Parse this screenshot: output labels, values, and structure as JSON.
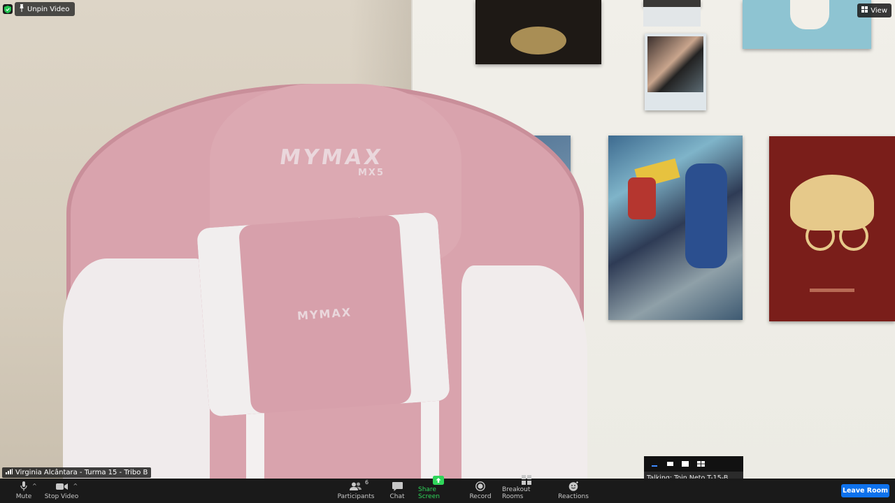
{
  "meeting": {
    "unpin_label": "Unpin Video",
    "view_label": "View",
    "participant_name": "Virginia Alcântara - Turma 15 - Tribo B",
    "talking_text": "Talking: Toin Neto T-15-B"
  },
  "scene": {
    "chair_logo": "MYMAX",
    "chair_logo_sub": "MX5",
    "pillow_logo": "MYMAX"
  },
  "toolbar": {
    "mute_label": "Mute",
    "stop_video_label": "Stop Video",
    "participants_label": "Participants",
    "participants_count": "6",
    "chat_label": "Chat",
    "share_screen_label": "Share Screen",
    "record_label": "Record",
    "breakout_rooms_label": "Breakout Rooms",
    "reactions_label": "Reactions",
    "leave_label": "Leave Room"
  },
  "colors": {
    "accent_blue": "#0e72ed",
    "share_green": "#2fd65a",
    "toolbar_bg": "#1a1a1a"
  }
}
